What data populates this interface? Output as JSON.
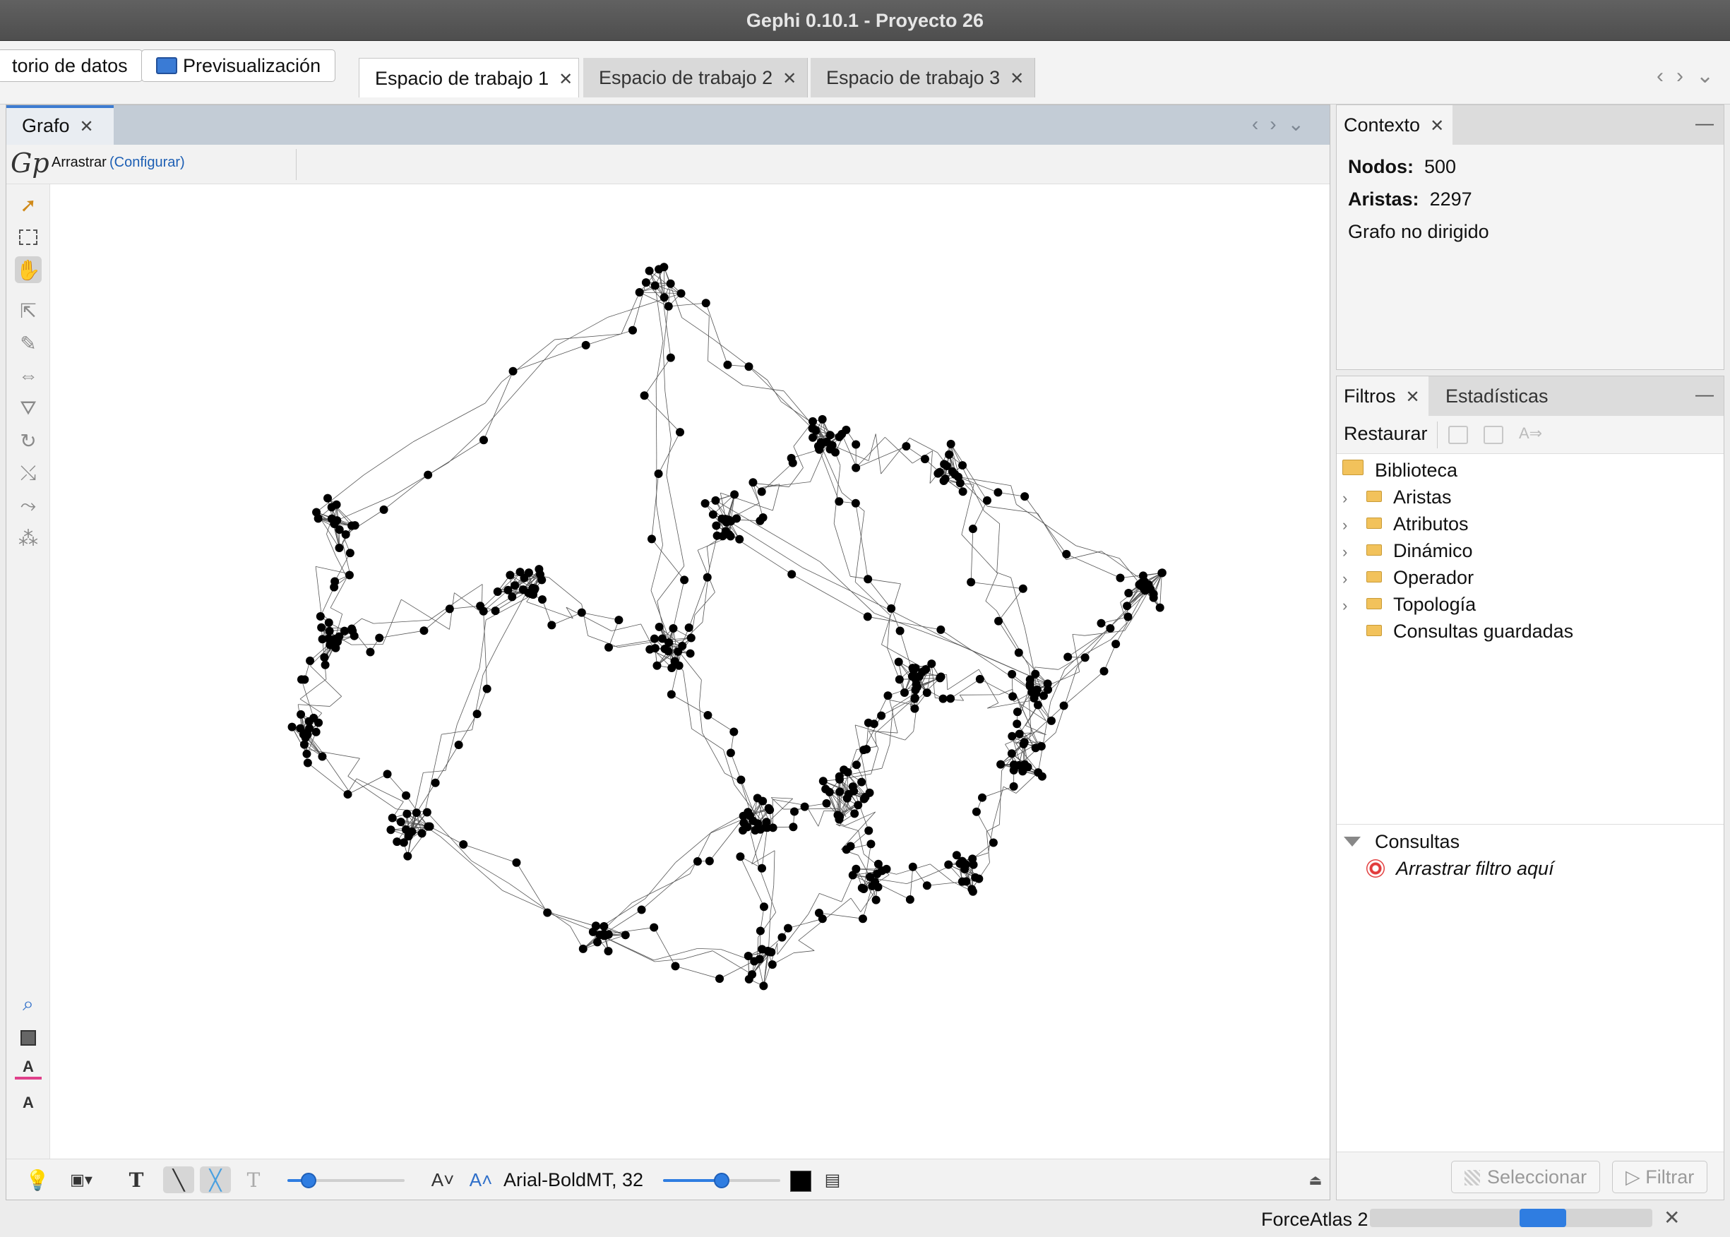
{
  "window": {
    "title": "Gephi 0.10.1 - Proyecto 26"
  },
  "mode_buttons": {
    "data_lab": "torio de datos",
    "preview": "Previsualización"
  },
  "workspaces": [
    {
      "label": "Espacio de trabajo 1",
      "active": true
    },
    {
      "label": "Espacio de trabajo 2",
      "active": false
    },
    {
      "label": "Espacio de trabajo 3",
      "active": false
    }
  ],
  "graph_panel": {
    "tab": "Grafo",
    "tool_name": "Arrastrar",
    "configure": "(Configurar)",
    "font_label": "Arial-BoldMT, 32",
    "label_size_slider": 0.18,
    "font_size_slider": 0.5,
    "label_color": "#000000",
    "node_color": "#000000",
    "edge_color": "#555555"
  },
  "context": {
    "tab": "Contexto",
    "nodes_label": "Nodos:",
    "nodes_value": "500",
    "edges_label": "Aristas:",
    "edges_value": "2297",
    "graph_type": "Grafo no dirigido"
  },
  "filters": {
    "tabs": [
      "Filtros",
      "Estadísticas"
    ],
    "restore": "Restaurar",
    "library_root": "Biblioteca",
    "library_items": [
      "Aristas",
      "Atributos",
      "Dinámico",
      "Operador",
      "Topología",
      "Consultas guardadas"
    ],
    "queries_label": "Consultas",
    "drop_hint": "Arrastrar filtro aquí",
    "select_button": "Seleccionar",
    "filter_button": "Filtrar"
  },
  "status": {
    "layout": "ForceAtlas 2",
    "progress": 0.53
  },
  "colors": {
    "accent": "#2f7de1",
    "folder": "#f2c25b",
    "link": "#1d5fb4"
  }
}
